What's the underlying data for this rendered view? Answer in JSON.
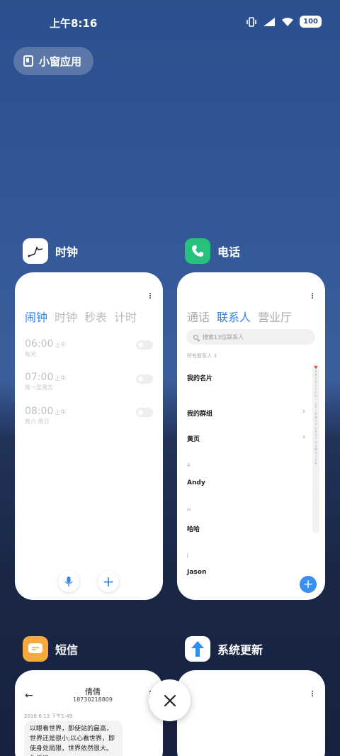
{
  "status_bar": {
    "time": "上午8:16",
    "battery": "100"
  },
  "floating_window_button": {
    "label": "小窗应用"
  },
  "clock": {
    "app_name": "时钟",
    "tabs": [
      "闹钟",
      "时钟",
      "秒表",
      "计时"
    ],
    "alarms": [
      {
        "time": "06:00",
        "ampm": "上午",
        "days": "每天"
      },
      {
        "time": "07:00",
        "ampm": "上午",
        "days": "周一至周五"
      },
      {
        "time": "08:00",
        "ampm": "上午",
        "days": "周六 周日"
      }
    ]
  },
  "phone": {
    "app_name": "电话",
    "tabs": [
      "通话",
      "联系人",
      "营业厅"
    ],
    "search_placeholder": "搜索13位联系人",
    "filter": "所有联系人",
    "my_card": "我的名片",
    "my_groups": "我的群组",
    "yellow_pages": "黄页",
    "sections": [
      {
        "letter": "A",
        "name": "Andy"
      },
      {
        "letter": "H",
        "name": "哈哈"
      },
      {
        "letter": "J",
        "name": "Jason"
      }
    ],
    "alphabet": [
      "A",
      "B",
      "C",
      "D",
      "E",
      "F",
      "G",
      "H",
      "I",
      "J",
      "K",
      "L",
      "M",
      "N",
      "O",
      "P",
      "Q",
      "R",
      "S",
      "T",
      "U",
      "V",
      "W",
      "X",
      "Y",
      "Z",
      "#"
    ]
  },
  "sms": {
    "app_name": "短信",
    "contact": "倩倩",
    "number": "18730218809",
    "date": "2016-6-13 下午1:49",
    "message": "以眼看世界，即使站的最高，世界还是很小;以心看世界，即使身处局限，世界依然很大。生活远"
  },
  "update": {
    "app_name": "系统更新"
  },
  "colors": {
    "accent": "#3482e8",
    "clock_icon_bg": "#ffffff",
    "phone_icon_bg": "#27c07c",
    "sms_icon_bg": "#f7a93b"
  }
}
